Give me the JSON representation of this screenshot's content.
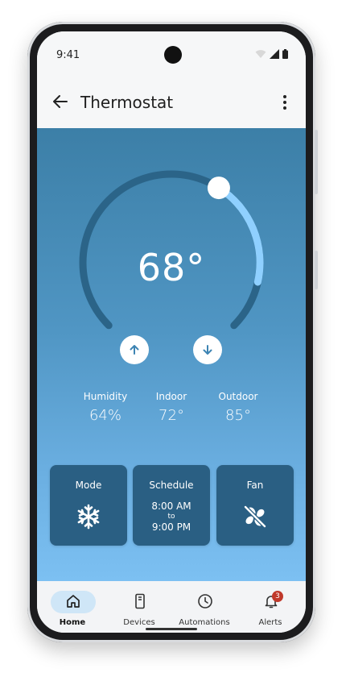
{
  "status_bar": {
    "time": "9:41"
  },
  "app_bar": {
    "title": "Thermostat"
  },
  "thermostat": {
    "current_temp": "68°",
    "setpoint_fraction": 0.62
  },
  "stats": [
    {
      "label": "Humidity",
      "value": "64%"
    },
    {
      "label": "Indoor",
      "value": "72°"
    },
    {
      "label": "Outdoor",
      "value": "85°"
    }
  ],
  "cards": {
    "mode": {
      "label": "Mode",
      "icon": "snowflake-icon"
    },
    "schedule": {
      "label": "Schedule",
      "start": "8:00 AM",
      "to": "to",
      "end": "9:00 PM"
    },
    "fan": {
      "label": "Fan",
      "icon": "fan-off-icon"
    }
  },
  "nav": {
    "items": [
      {
        "label": "Home",
        "icon": "home-icon",
        "active": true
      },
      {
        "label": "Devices",
        "icon": "devices-icon"
      },
      {
        "label": "Automations",
        "icon": "clock-icon"
      },
      {
        "label": "Alerts",
        "icon": "bell-icon",
        "badge": "3"
      }
    ]
  },
  "colors": {
    "gradient_top": "#3c7fa7",
    "gradient_bottom": "#7cc0f2",
    "card_bg": "#2a5f83",
    "dial_track": "#2b6488",
    "dial_active": "#8fd0ff",
    "badge": "#c0392b",
    "active_pill": "#cfe6f7"
  }
}
